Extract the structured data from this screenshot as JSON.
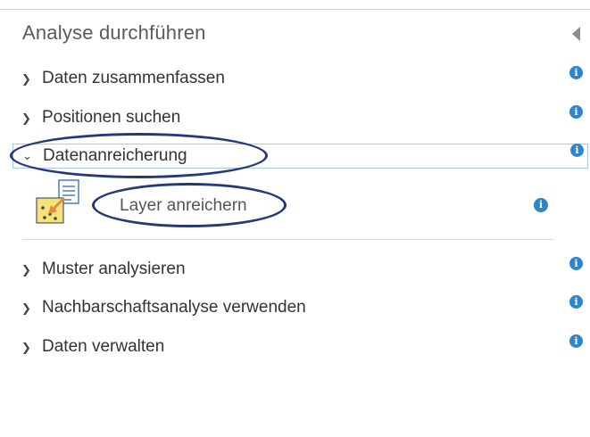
{
  "panel": {
    "title": "Analyse durchführen",
    "collapse_icon": "collapse-left-icon"
  },
  "categories": [
    {
      "label": "Daten zusammenfassen",
      "expanded": false,
      "icon": "chevron-right-icon"
    },
    {
      "label": "Positionen suchen",
      "expanded": false,
      "icon": "chevron-right-icon"
    },
    {
      "label": "Datenanreicherung",
      "expanded": true,
      "icon": "chevron-down-icon"
    },
    {
      "label": "Muster analysieren",
      "expanded": false,
      "icon": "chevron-right-icon"
    },
    {
      "label": "Nachbarschaftsanalyse verwenden",
      "expanded": false,
      "icon": "chevron-right-icon"
    },
    {
      "label": "Daten verwalten",
      "expanded": false,
      "icon": "chevron-right-icon"
    }
  ],
  "tools": [
    {
      "label": "Layer anreichern",
      "icon": "enrich-layer-icon"
    }
  ],
  "info_icon": "info-icon",
  "colors": {
    "accent": "#2e85c8",
    "annotation": "#243a78",
    "selection_border": "#a9c8ec"
  }
}
